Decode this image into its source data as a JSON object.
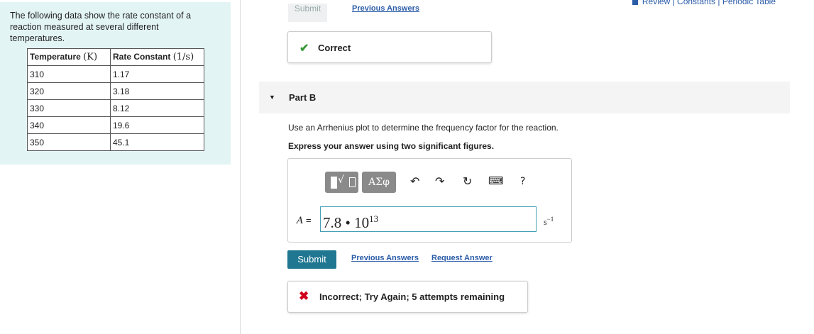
{
  "header": {
    "links_text": "Review | Constants | Periodic Table",
    "review_icon_color": "#2b5ca8"
  },
  "problem": {
    "intro": "The following data show the rate constant of a reaction measured at several different temperatures.",
    "table": {
      "headers": [
        {
          "label": "Temperature",
          "unit": "(K)"
        },
        {
          "label": "Rate Constant",
          "unit": "(1/s)"
        }
      ],
      "rows": [
        [
          "310",
          "1.17"
        ],
        [
          "320",
          "3.18"
        ],
        [
          "330",
          "8.12"
        ],
        [
          "340",
          "19.6"
        ],
        [
          "350",
          "45.1"
        ]
      ]
    }
  },
  "part_a": {
    "submit_label": "Submit",
    "previous_answers_label": "Previous Answers",
    "feedback": "Correct",
    "feedback_color": "#3a9a3a"
  },
  "part_b": {
    "title": "Part B",
    "question": "Use an Arrhenius plot to determine the frequency factor for the reaction.",
    "instruction": "Express your answer using two significant figures.",
    "toolbar": {
      "greek_label": "ΑΣφ",
      "undo_icon": "undo-icon",
      "redo_icon": "redo-icon",
      "reset_icon": "reset-icon",
      "keyboard_icon": "keyboard-icon",
      "help_label": "?"
    },
    "answer": {
      "variable": "A",
      "equals": "=",
      "mantissa": "7.8 • 10",
      "exponent": "13",
      "unit_base": "s",
      "unit_exp": "−1"
    },
    "submit_label": "Submit",
    "previous_answers_label": "Previous Answers",
    "request_answer_label": "Request Answer",
    "feedback": "Incorrect; Try Again; 5 attempts remaining",
    "feedback_color": "#d0021b",
    "submit_color": "#1f7791"
  }
}
